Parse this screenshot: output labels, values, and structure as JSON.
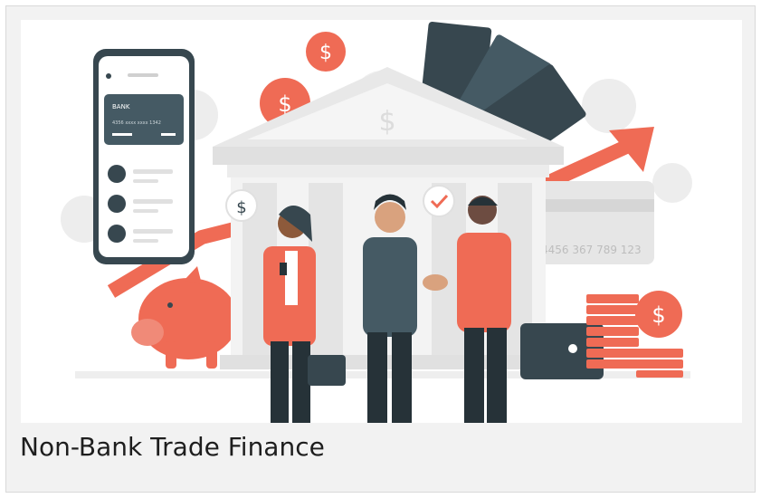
{
  "card": {
    "title": "Non-Bank Trade Finance"
  },
  "illustration": {
    "subject": "bank building with people shaking hands, phone banking app, piggy bank, coins, cash, rising arrow",
    "phone_card_label": "BANK",
    "phone_card_number": "4356 xxxx xxxx 1342",
    "credit_card_number": "4456 367 789 123",
    "colors": {
      "accent": "#ef6b55",
      "dark": "#37474f",
      "light_gray": "#e4e4e4",
      "building": "#f0f0f0"
    }
  }
}
